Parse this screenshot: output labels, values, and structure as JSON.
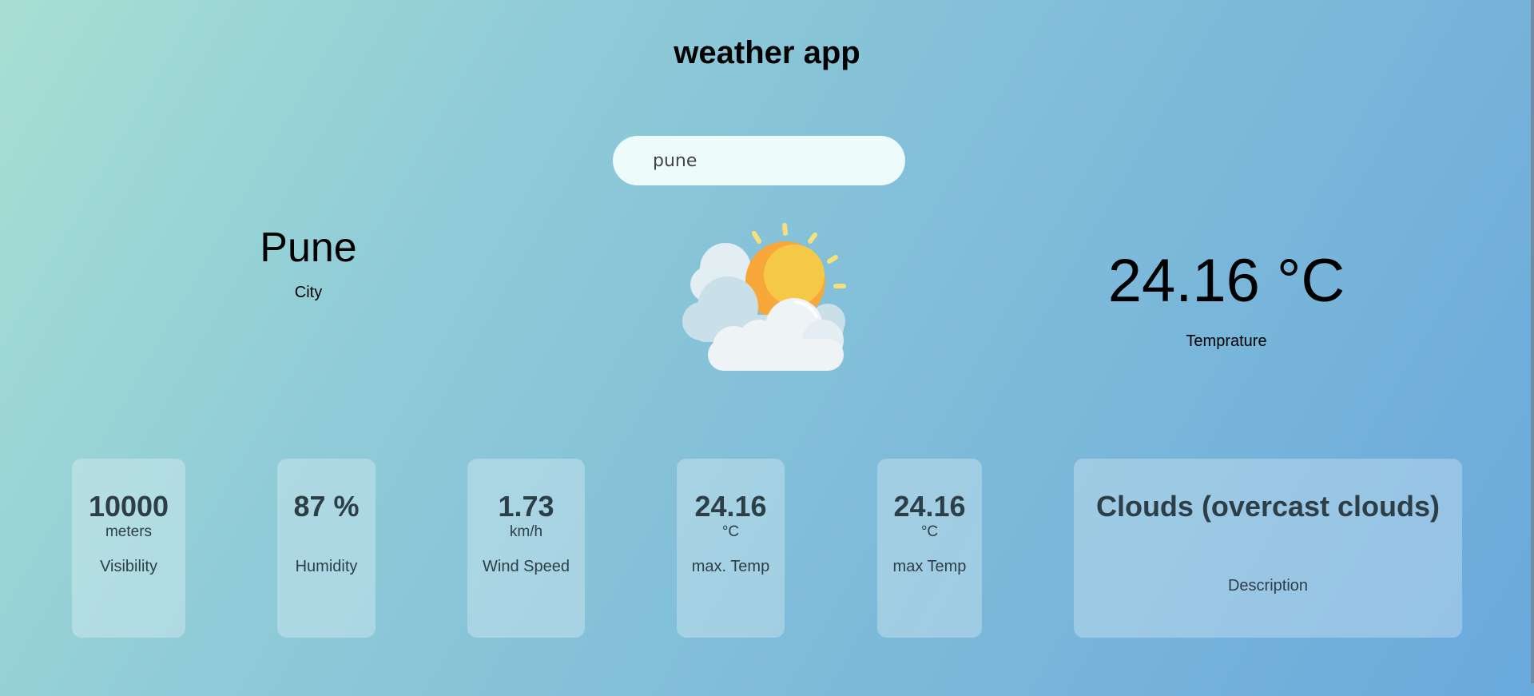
{
  "app": {
    "title": "weather app"
  },
  "search": {
    "value": "pune",
    "placeholder": ""
  },
  "city": {
    "name": "Pune",
    "caption": "City"
  },
  "weather_icon": "sun-behind-clouds-icon",
  "temperature": {
    "value": "24.16 °C",
    "caption": "Temprature"
  },
  "cards": [
    {
      "value": "10000",
      "unit": "meters",
      "label": "Visibility"
    },
    {
      "value": "87 %",
      "unit": "",
      "label": "Humidity"
    },
    {
      "value": "1.73",
      "unit": "km/h",
      "label": "Wind Speed"
    },
    {
      "value": "24.16",
      "unit": "°C",
      "label": "max. Temp"
    },
    {
      "value": "24.16",
      "unit": "°C",
      "label": "max Temp"
    },
    {
      "value": "Clouds (overcast clouds)",
      "unit": "",
      "label": "Description"
    }
  ],
  "colors": {
    "card_text": "#2d3e46",
    "sun": "#f8a83a",
    "sun_highlight": "#f5c947",
    "cloud": "#eef3f6",
    "cloud_shade": "#c9e0e8"
  }
}
